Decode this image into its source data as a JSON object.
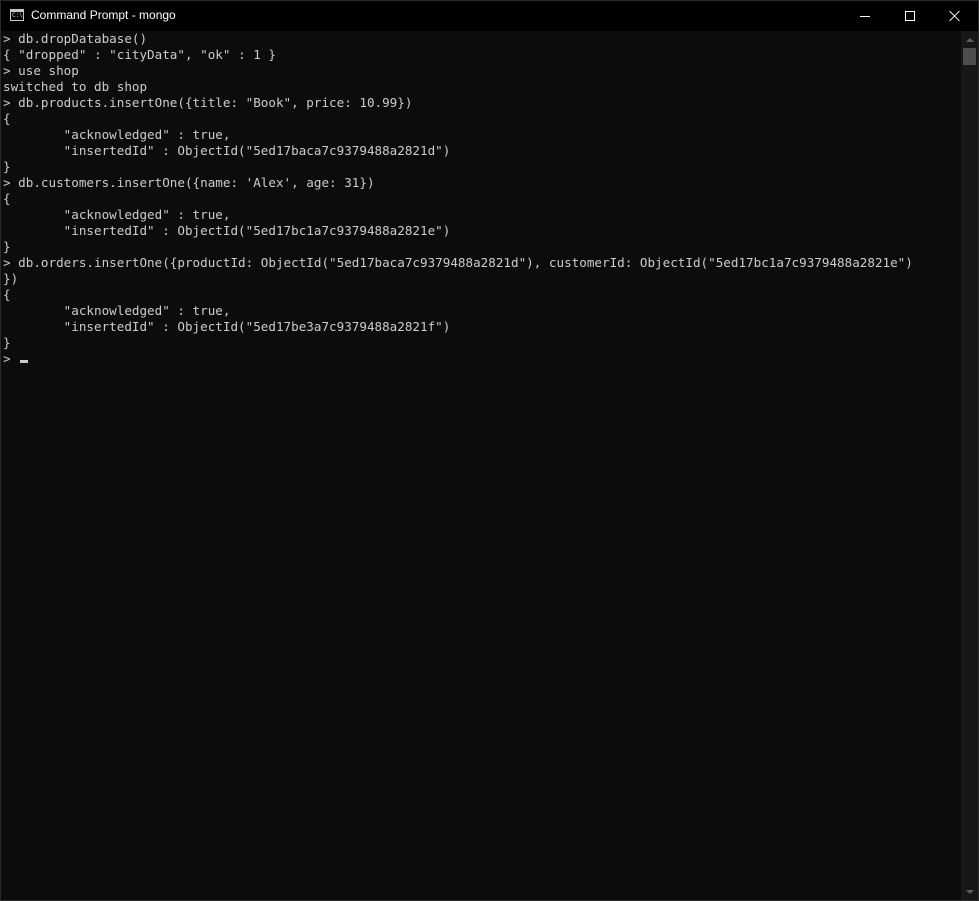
{
  "window": {
    "title": "Command Prompt - mongo",
    "icon": "cmd-icon",
    "icon_text": "C:\\",
    "controls": {
      "minimize": "minimize-icon",
      "maximize": "maximize-icon",
      "close": "close-icon"
    }
  },
  "console": {
    "lines": [
      "> db.dropDatabase()",
      "{ \"dropped\" : \"cityData\", \"ok\" : 1 }",
      "> use shop",
      "switched to db shop",
      "> db.products.insertOne({title: \"Book\", price: 10.99})",
      "{",
      "        \"acknowledged\" : true,",
      "        \"insertedId\" : ObjectId(\"5ed17baca7c9379488a2821d\")",
      "}",
      "> db.customers.insertOne({name: 'Alex', age: 31})",
      "{",
      "        \"acknowledged\" : true,",
      "        \"insertedId\" : ObjectId(\"5ed17bc1a7c9379488a2821e\")",
      "}",
      "> db.orders.insertOne({productId: ObjectId(\"5ed17baca7c9379488a2821d\"), customerId: ObjectId(\"5ed17bc1a7c9379488a2821e\")",
      "})",
      "{",
      "        \"acknowledged\" : true,",
      "        \"insertedId\" : ObjectId(\"5ed17be3a7c9379488a2821f\")",
      "}"
    ],
    "prompt": "> "
  },
  "colors": {
    "background": "#0c0c0c",
    "text": "#cccccc",
    "titlebar": "#000000"
  }
}
